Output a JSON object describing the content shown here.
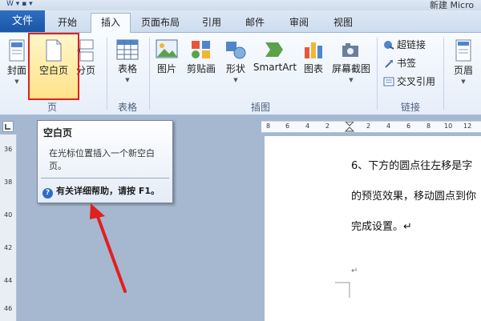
{
  "window": {
    "app_title": "新建 Micro"
  },
  "tabs": [
    "文件",
    "开始",
    "插入",
    "页面布局",
    "引用",
    "邮件",
    "审阅",
    "视图"
  ],
  "ribbon": {
    "pages_group": {
      "cover": "封面",
      "blank": "空白页",
      "break": "分页",
      "label": "页"
    },
    "tables_group": {
      "table": "表格",
      "label": "表格"
    },
    "illustrations_group": {
      "picture": "图片",
      "clipart": "剪贴画",
      "shapes": "形状",
      "smartart": "SmartArt",
      "chart": "图表",
      "screenshot": "屏幕截图",
      "label": "插图"
    },
    "links_group": {
      "hyperlink": "超链接",
      "bookmark": "书签",
      "crossref": "交叉引用",
      "label": "链接"
    },
    "header_group": {
      "header": "页眉"
    }
  },
  "tooltip": {
    "title": "空白页",
    "description": "在光标位置插入一个新空白页。",
    "help": "有关详细帮助，请按 F1。"
  },
  "document": {
    "line1": "6、下方的圆点往左移是字",
    "line2": "的预览效果，移动圆点到你",
    "line3": "完成设置。↵",
    "line4": "↵"
  },
  "hruler_ticks": [
    "8",
    "6",
    "4",
    "2",
    "",
    "2",
    "4",
    "6",
    "8",
    "10",
    "12"
  ],
  "vruler_ticks": [
    "36",
    "38",
    "40",
    "42",
    "44",
    "46"
  ],
  "colors": {
    "file_tab": "#2f6fc0",
    "highlight": "#e02020",
    "accent": "#2e6bc6"
  }
}
